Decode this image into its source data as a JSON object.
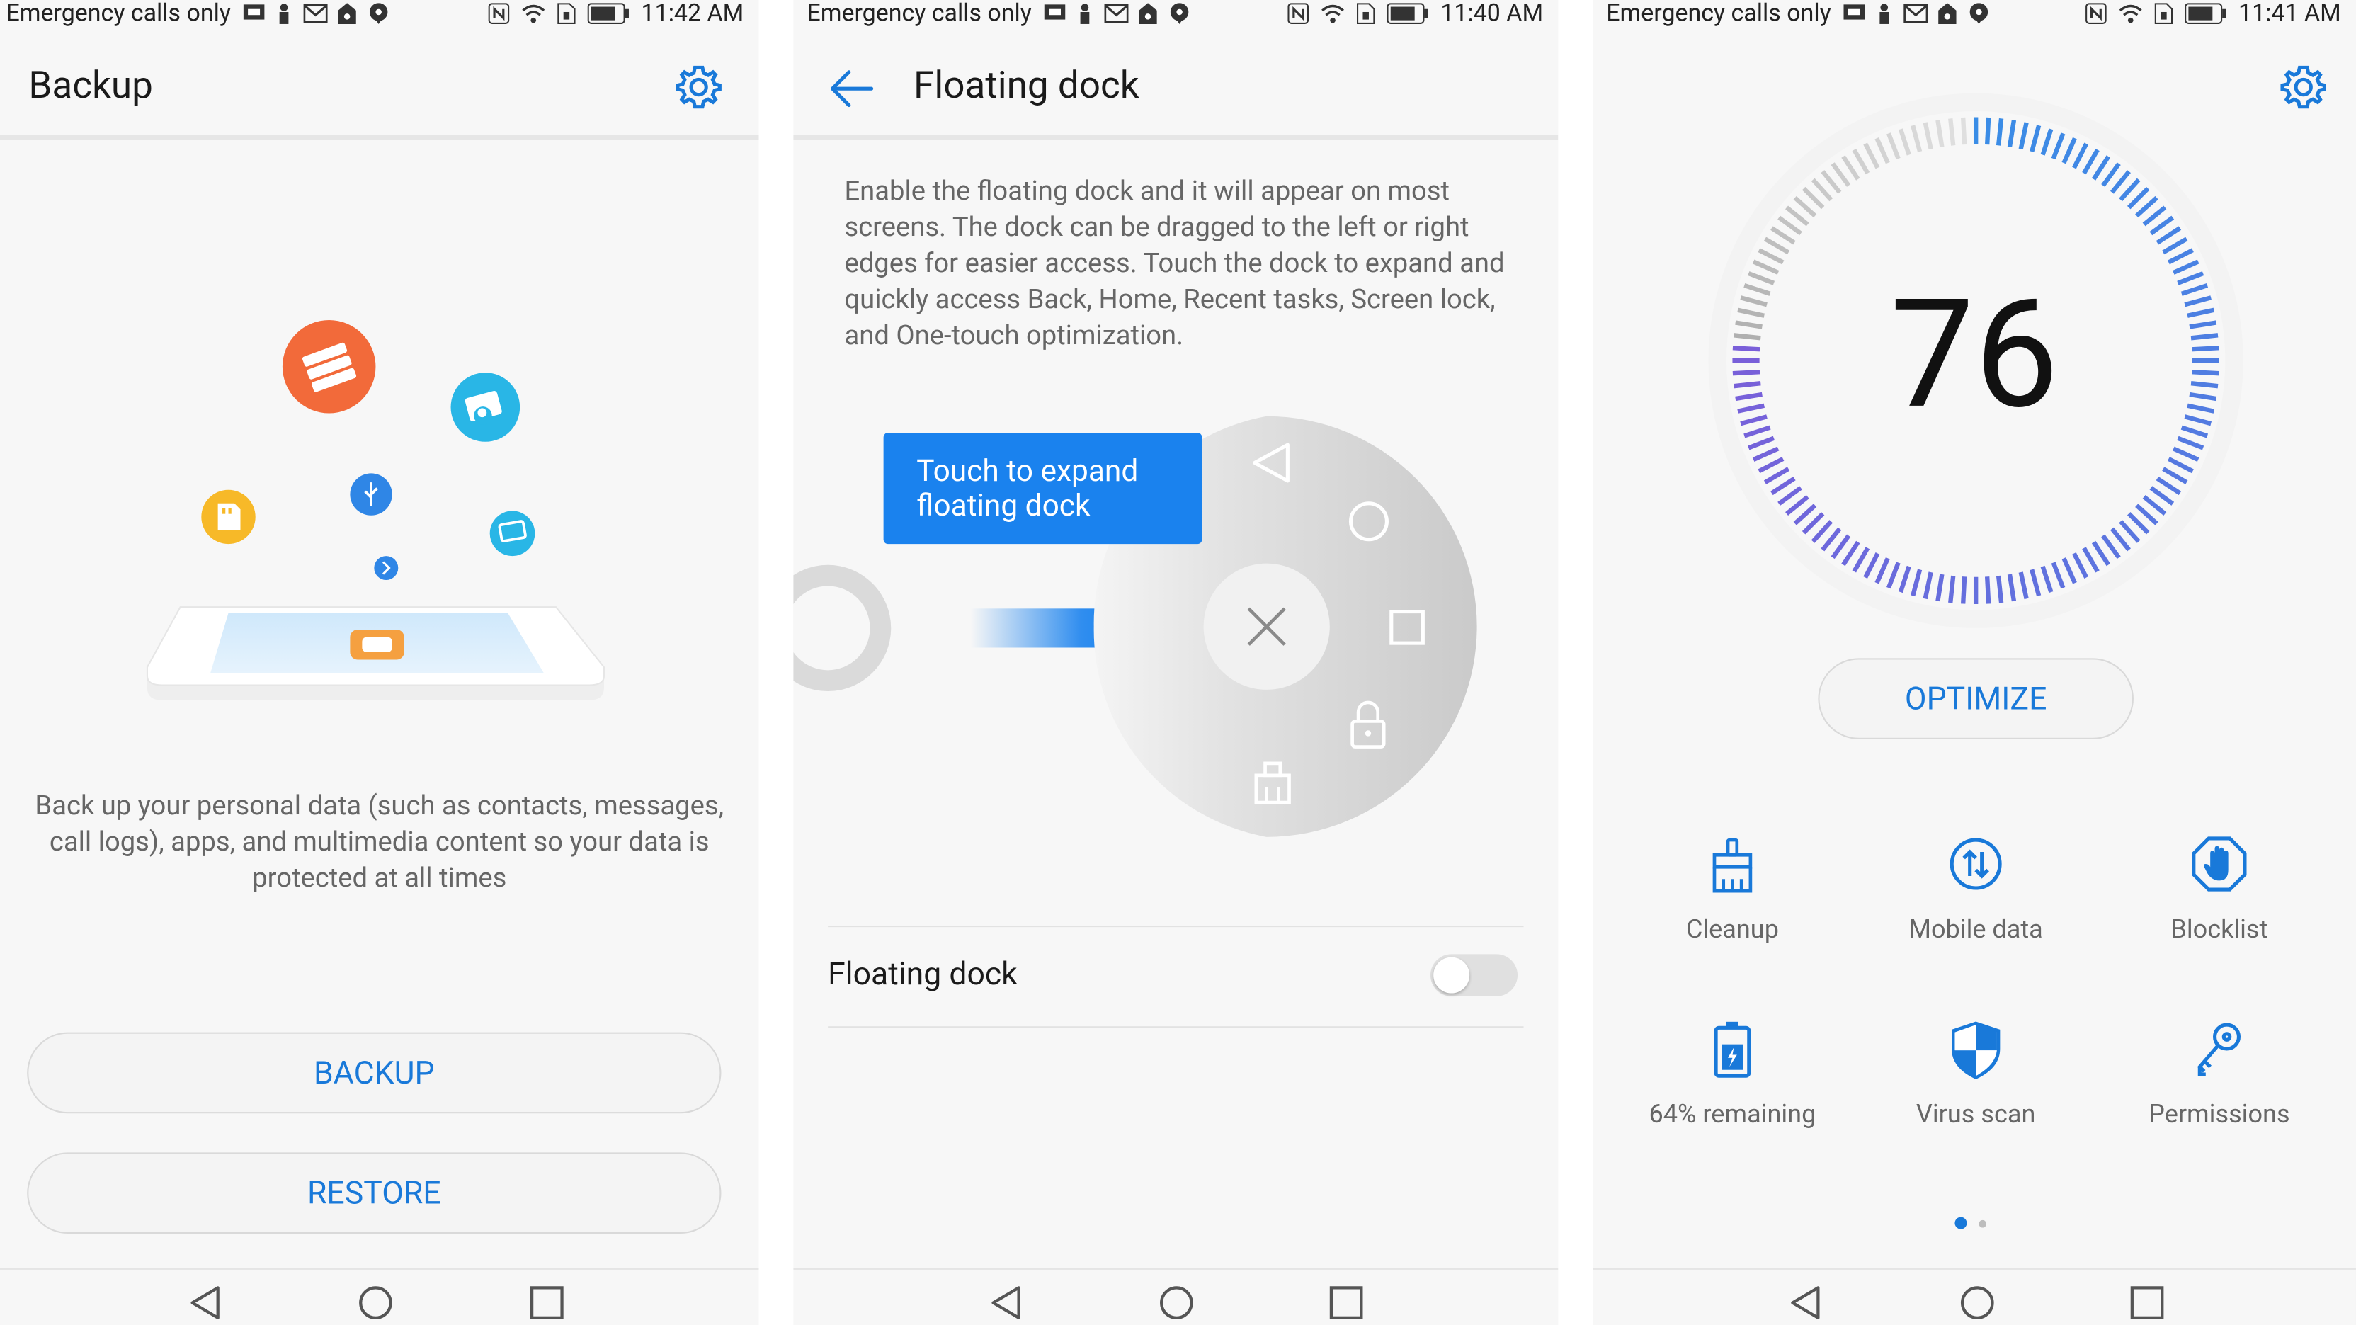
{
  "status_bars": [
    {
      "carrier": "Emergency calls only",
      "time": "11:42 AM"
    },
    {
      "carrier": "Emergency calls only",
      "time": "11:40 AM"
    },
    {
      "carrier": "Emergency calls only",
      "time": "11:41 AM"
    }
  ],
  "backup_screen": {
    "title": "Backup",
    "description": "Back up your personal data (such as contacts, messages, call logs), apps, and multimedia content so your data is protected at all times",
    "backup_label": "BACKUP",
    "restore_label": "RESTORE"
  },
  "floating_dock_screen": {
    "title": "Floating dock",
    "description": "Enable the floating dock and it will appear on most screens. The dock can be dragged to the left or right edges for easier access. Touch the dock to expand and quickly access Back, Home, Recent tasks, Screen lock, and One-touch optimization.",
    "tooltip_line1": "Touch to expand",
    "tooltip_line2": "floating dock",
    "setting_label": "Floating dock",
    "toggle_on": false
  },
  "manager_screen": {
    "score": "76",
    "optimize_label": "OPTIMIZE",
    "tools": [
      {
        "label": "Cleanup",
        "icon": "broom-icon"
      },
      {
        "label": "Mobile data",
        "icon": "data-transfer-icon"
      },
      {
        "label": "Blocklist",
        "icon": "hand-block-icon"
      },
      {
        "label": "64% remaining",
        "icon": "battery-icon"
      },
      {
        "label": "Virus scan",
        "icon": "shield-icon"
      },
      {
        "label": "Permissions",
        "icon": "key-icon"
      }
    ],
    "page_count": 2,
    "active_page": 1
  },
  "colors": {
    "accent": "#1979d9",
    "orange": "#f26a3a",
    "teal": "#29b6e6",
    "yellow": "#f7b928",
    "dial_gradient_start": "#3a8de6",
    "dial_gradient_end": "#7a5fd9",
    "toggle_off": "#e0e0e0"
  }
}
